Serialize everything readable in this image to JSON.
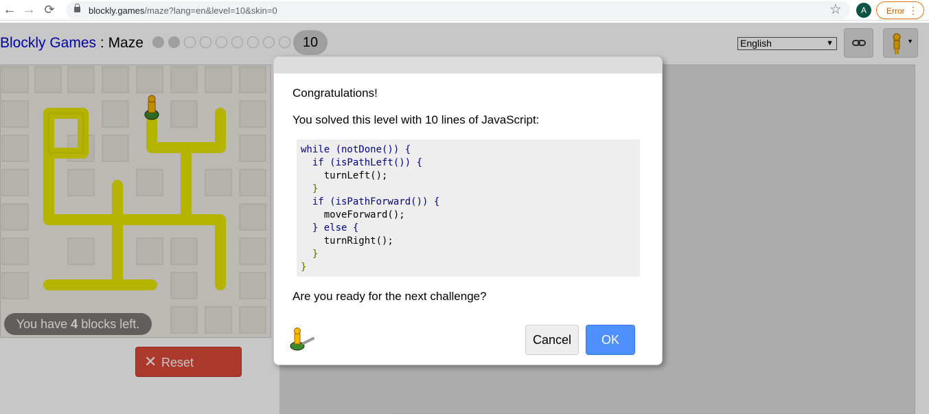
{
  "browser": {
    "url_host": "blockly.games",
    "url_path": "/maze?lang=en&level=10&skin=0",
    "profile_initial": "A",
    "error_label": "Error"
  },
  "header": {
    "brand": "Blockly Games",
    "separator": " : ",
    "game": "Maze",
    "current_level": "10",
    "levels_completed": 2,
    "levels_total": 10,
    "language": "English"
  },
  "maze": {
    "blocks_left_prefix": "You have ",
    "blocks_left_count": "4",
    "blocks_left_suffix": " blocks left.",
    "reset_label": "Reset"
  },
  "dialog": {
    "congrats": "Congratulations!",
    "solved": "You solved this level with 10 lines of JavaScript:",
    "code_lines": [
      "while (notDone()) {",
      "  if (isPathLeft()) {",
      "    turnLeft();",
      "  }",
      "  if (isPathForward()) {",
      "    moveForward();",
      "  } else {",
      "    turnRight();",
      "  }",
      "}"
    ],
    "question": "Are you ready for the next challenge?",
    "cancel_label": "Cancel",
    "ok_label": "OK"
  },
  "colors": {
    "path": "#e6e600",
    "reset": "#dd4b39",
    "ok": "#4d90fe"
  }
}
